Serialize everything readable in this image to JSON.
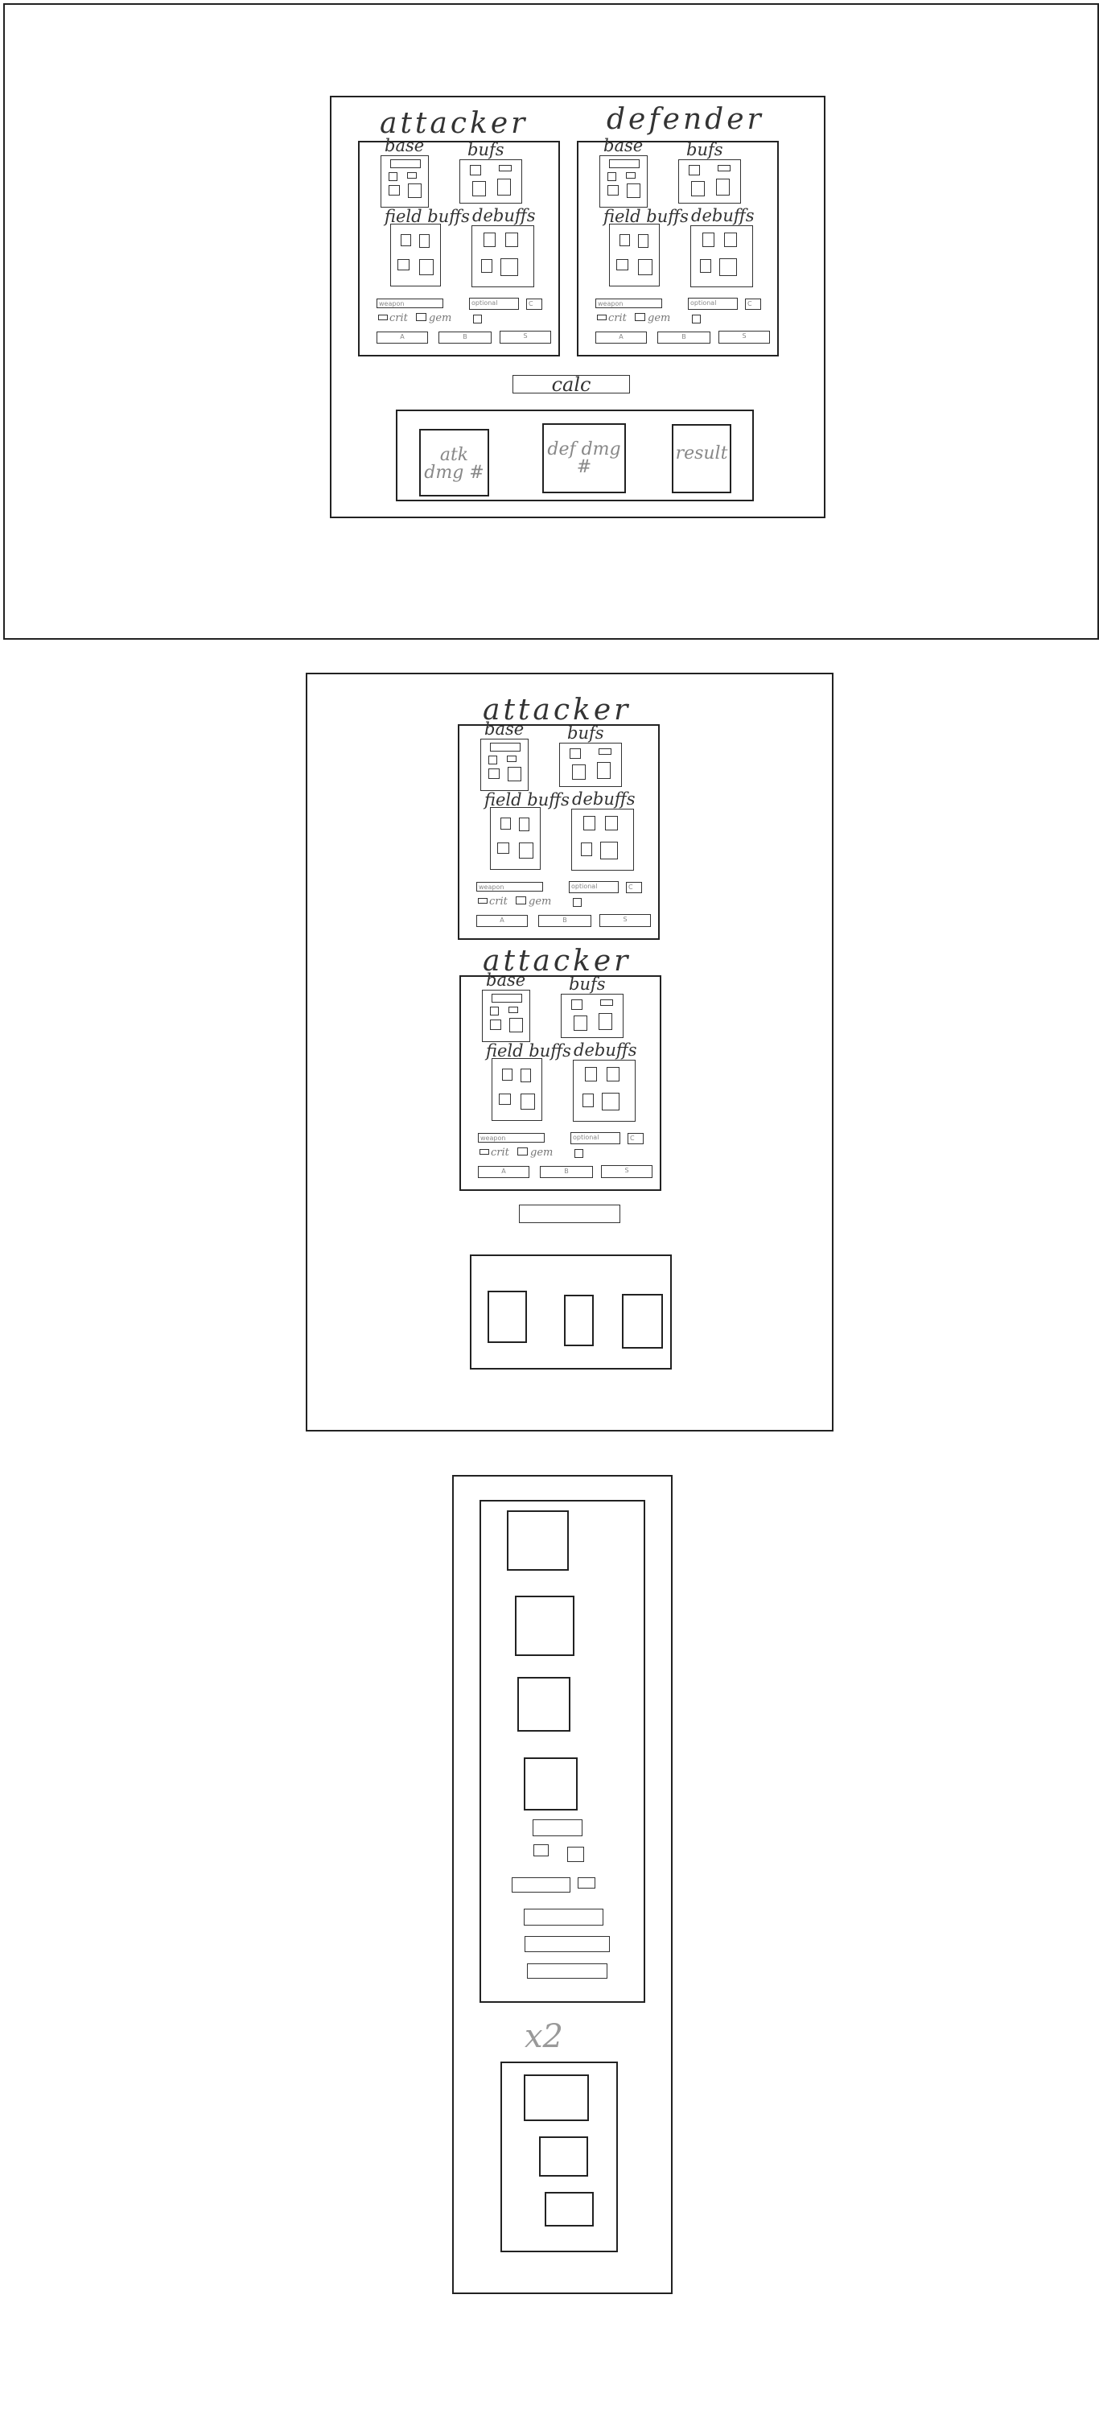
{
  "sketch1": {
    "attacker_title": "attacker",
    "defender_title": "defender",
    "calc_label": "calc",
    "atk_dmg_label": "atk dmg #",
    "def_dmg_label": "def dmg #",
    "result_label": "result"
  },
  "panel": {
    "base": "base",
    "buffs": "bufs",
    "field_buffs": "field buffs",
    "debuffs": "debuffs",
    "weapon": "weapon",
    "optional": "optional",
    "crit_box": "C",
    "crit_text": "crit",
    "gem_text": "gem",
    "btn_a": "A",
    "btn_b": "B",
    "btn_s": "S"
  },
  "sketch2": {
    "title_1": "attacker",
    "title_2": "attacker"
  },
  "sketch3": {
    "multiplier": "x2"
  }
}
